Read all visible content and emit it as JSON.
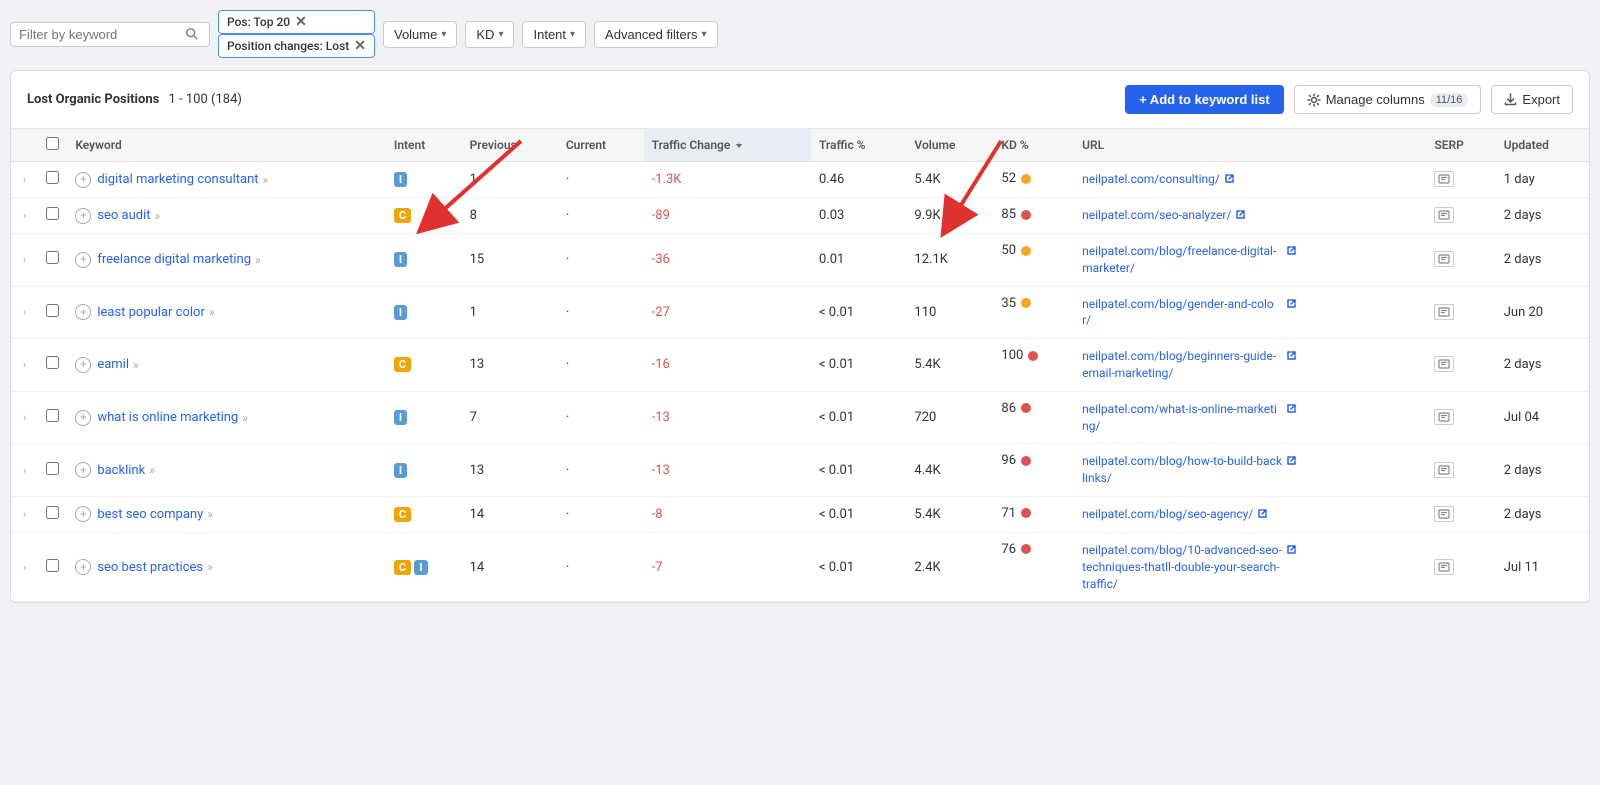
{
  "toolbar": {
    "filter_placeholder": "Filter by keyword",
    "tags": [
      {
        "label": "Pos: Top 20",
        "id": "pos-tag"
      },
      {
        "label": "Position changes: Lost",
        "id": "position-tag"
      }
    ],
    "dropdowns": [
      {
        "label": "Volume",
        "id": "volume-dd"
      },
      {
        "label": "KD",
        "id": "kd-dd"
      },
      {
        "label": "Intent",
        "id": "intent-dd"
      },
      {
        "label": "Advanced filters",
        "id": "adv-dd"
      }
    ]
  },
  "card": {
    "title": "Lost Organic Positions",
    "range": "1 - 100 (184)",
    "add_btn": "+ Add to keyword list",
    "manage_btn": "Manage columns",
    "manage_badge": "11/16",
    "export_btn": "Export"
  },
  "columns": [
    {
      "key": "keyword",
      "label": "Keyword"
    },
    {
      "key": "intent",
      "label": "Intent"
    },
    {
      "key": "previous",
      "label": "Previous"
    },
    {
      "key": "current",
      "label": "Current"
    },
    {
      "key": "traffic_change",
      "label": "Traffic Change",
      "sorted": true
    },
    {
      "key": "traffic_pct",
      "label": "Traffic %"
    },
    {
      "key": "volume",
      "label": "Volume"
    },
    {
      "key": "kd",
      "label": "KD %"
    },
    {
      "key": "url",
      "label": "URL"
    },
    {
      "key": "serp",
      "label": "SERP"
    },
    {
      "key": "updated",
      "label": "Updated"
    }
  ],
  "rows": [
    {
      "keyword": "digital marketing consultant",
      "intent": "I",
      "intent_type": "i",
      "previous": "1",
      "current": "·",
      "traffic_change": "-1.3K",
      "traffic_pct": "0.46",
      "volume": "5.4K",
      "kd": "52",
      "kd_color": "orange",
      "url": "neilpatel.com/consulting/",
      "serp": "",
      "updated": "1 day"
    },
    {
      "keyword": "seo audit",
      "intent": "C",
      "intent_type": "c",
      "previous": "8",
      "current": "·",
      "traffic_change": "-89",
      "traffic_pct": "0.03",
      "volume": "9.9K",
      "kd": "85",
      "kd_color": "red",
      "url": "neilpatel.com/seo-analyzer/",
      "serp": "",
      "updated": "2 days"
    },
    {
      "keyword": "freelance digital marketing",
      "intent": "I",
      "intent_type": "i",
      "previous": "15",
      "current": "·",
      "traffic_change": "-36",
      "traffic_pct": "0.01",
      "volume": "12.1K",
      "kd": "50",
      "kd_color": "orange",
      "url": "neilpatel.com/blog/freelance-digital-marketer/",
      "serp": "",
      "updated": "2 days"
    },
    {
      "keyword": "least popular color",
      "intent": "I",
      "intent_type": "i",
      "previous": "1",
      "current": "·",
      "traffic_change": "-27",
      "traffic_pct": "< 0.01",
      "volume": "110",
      "kd": "35",
      "kd_color": "orange",
      "url": "neilpatel.com/blog/gender-and-color/",
      "serp": "",
      "updated": "Jun 20"
    },
    {
      "keyword": "eamil",
      "intent": "C",
      "intent_type": "c",
      "previous": "13",
      "current": "·",
      "traffic_change": "-16",
      "traffic_pct": "< 0.01",
      "volume": "5.4K",
      "kd": "100",
      "kd_color": "red",
      "url": "neilpatel.com/blog/beginners-guide-email-marketing/",
      "serp": "",
      "updated": "2 days"
    },
    {
      "keyword": "what is online marketing",
      "intent": "I",
      "intent_type": "i",
      "previous": "7",
      "current": "·",
      "traffic_change": "-13",
      "traffic_pct": "< 0.01",
      "volume": "720",
      "kd": "86",
      "kd_color": "red",
      "url": "neilpatel.com/what-is-online-marketing/",
      "serp": "",
      "updated": "Jul 04"
    },
    {
      "keyword": "backlink",
      "intent": "I",
      "intent_type": "i",
      "previous": "13",
      "current": "·",
      "traffic_change": "-13",
      "traffic_pct": "< 0.01",
      "volume": "4.4K",
      "kd": "96",
      "kd_color": "red",
      "url": "neilpatel.com/blog/how-to-build-backlinks/",
      "serp": "",
      "updated": "2 days"
    },
    {
      "keyword": "best seo company",
      "intent": "C",
      "intent_type": "c",
      "previous": "14",
      "current": "·",
      "traffic_change": "-8",
      "traffic_pct": "< 0.01",
      "volume": "5.4K",
      "kd": "71",
      "kd_color": "red",
      "url": "neilpatel.com/blog/seo-agency/",
      "serp": "",
      "updated": "2 days"
    },
    {
      "keyword": "seo best practices",
      "intent": "C+I",
      "intent_type": "ci",
      "previous": "14",
      "current": "·",
      "traffic_change": "-7",
      "traffic_pct": "< 0.01",
      "volume": "2.4K",
      "kd": "76",
      "kd_color": "red",
      "url": "neilpatel.com/blog/10-advanced-seo-techniques-thatll-double-your-search-traffic/",
      "serp": "",
      "updated": "Jul 11"
    }
  ],
  "arrows": {
    "intent_label": "Intent arrow pointing to column",
    "kd_label": "KD arrow pointing to column"
  }
}
